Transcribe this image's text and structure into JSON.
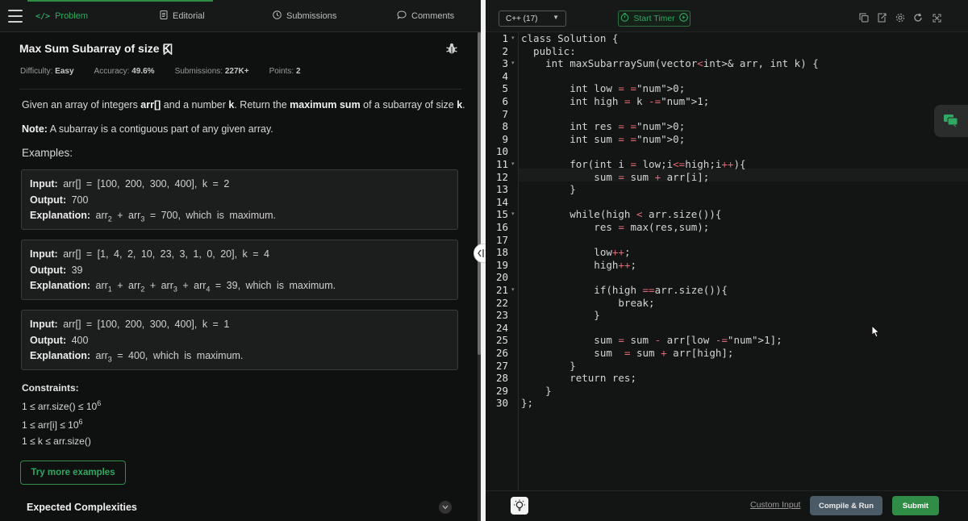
{
  "nav": {
    "tabs": [
      {
        "label": "Problem",
        "icon": "code-icon",
        "active": true
      },
      {
        "label": "Editorial",
        "icon": "document-icon"
      },
      {
        "label": "Submissions",
        "icon": "clock-icon"
      },
      {
        "label": "Comments",
        "icon": "chat-bubble-icon"
      }
    ]
  },
  "problem": {
    "title": "Max Sum Subarray of size K",
    "meta": {
      "difficulty_label": "Difficulty:",
      "difficulty": "Easy",
      "accuracy_label": "Accuracy:",
      "accuracy": "49.6%",
      "submissions_label": "Submissions:",
      "submissions": "227K+",
      "points_label": "Points:",
      "points": "2"
    },
    "description": {
      "p1": "Given an array of integers ",
      "arr": "arr[]",
      "p2": "  and a number ",
      "k": "k",
      "p3": ". Return the ",
      "maxsum": "maximum sum",
      "p4": " of a subarray of size ",
      "k2": "k",
      "p5": "."
    },
    "note_label": "Note:",
    "note_text": " A subarray is a contiguous part of any given array.",
    "examples_heading": "Examples:",
    "examples": [
      {
        "input_label": "Input:",
        "input": "arr[] = [100, 200, 300, 400], k = 2",
        "output_label": "Output:",
        "output": "700",
        "explanation_label": "Explanation:",
        "explanation": [
          {
            "t": "arr"
          },
          {
            "sub": "2"
          },
          {
            "t": " + arr"
          },
          {
            "sub": "3"
          },
          {
            "t": " = 700, which is maximum."
          }
        ]
      },
      {
        "input_label": "Input:",
        "input": "arr[] = [1, 4, 2, 10, 23, 3, 1, 0, 20], k = 4",
        "output_label": "Output:",
        "output": "39",
        "explanation_label": "Explanation:",
        "explanation": [
          {
            "t": "arr"
          },
          {
            "sub": "1"
          },
          {
            "t": " + arr"
          },
          {
            "sub": "2"
          },
          {
            "t": " + arr"
          },
          {
            "sub": "3"
          },
          {
            "t": " + arr"
          },
          {
            "sub": "4"
          },
          {
            "t": " = 39, which is maximum."
          }
        ]
      },
      {
        "input_label": "Input:",
        "input": "arr[] = [100, 200, 300, 400], k = 1",
        "output_label": "Output:",
        "output": "400",
        "explanation_label": "Explanation:",
        "explanation": [
          {
            "t": "arr"
          },
          {
            "sub": "3"
          },
          {
            "t": " = 400, which is maximum."
          }
        ]
      }
    ],
    "constraints_title": "Constraints:",
    "constraints": [
      {
        "base": "1 ≤ arr.size() ≤ 10",
        "sup": "6"
      },
      {
        "base": "1 ≤ arr[i] ≤ 10",
        "sup": "6"
      },
      {
        "base": "1 ≤ k ≤ arr.size()",
        "sup": ""
      }
    ],
    "try_more_label": "Try more examples",
    "expected_complexities": "Expected Complexities"
  },
  "editor": {
    "language": "C++ (17)",
    "timer_label": "Start Timer",
    "toolbar_icons": [
      "copy-icon",
      "export-icon",
      "settings-icon",
      "reset-icon",
      "fullscreen-icon"
    ],
    "code": [
      {
        "n": "1",
        "fold": true,
        "text": "class Solution {"
      },
      {
        "n": "2",
        "fold": false,
        "text": "  public:"
      },
      {
        "n": "3",
        "fold": true,
        "text": "    int maxSubarraySum(vector<int>& arr, int k) {"
      },
      {
        "n": "4",
        "fold": false,
        "text": ""
      },
      {
        "n": "5",
        "fold": false,
        "text": "        int low = 0;"
      },
      {
        "n": "6",
        "fold": false,
        "text": "        int high = k -1;"
      },
      {
        "n": "7",
        "fold": false,
        "text": ""
      },
      {
        "n": "8",
        "fold": false,
        "text": "        int res = 0;"
      },
      {
        "n": "9",
        "fold": false,
        "text": "        int sum = 0;"
      },
      {
        "n": "10",
        "fold": false,
        "text": ""
      },
      {
        "n": "11",
        "fold": true,
        "text": "        for(int i = low;i<=high;i++){"
      },
      {
        "n": "12",
        "fold": false,
        "text": "            sum = sum + arr[i];"
      },
      {
        "n": "13",
        "fold": false,
        "text": "        }"
      },
      {
        "n": "14",
        "fold": false,
        "text": ""
      },
      {
        "n": "15",
        "fold": true,
        "text": "        while(high < arr.size()){"
      },
      {
        "n": "16",
        "fold": false,
        "text": "            res = max(res,sum);"
      },
      {
        "n": "17",
        "fold": false,
        "text": ""
      },
      {
        "n": "18",
        "fold": false,
        "text": "            low++;"
      },
      {
        "n": "19",
        "fold": false,
        "text": "            high++;"
      },
      {
        "n": "20",
        "fold": false,
        "text": ""
      },
      {
        "n": "21",
        "fold": true,
        "text": "            if(high ==arr.size()){"
      },
      {
        "n": "22",
        "fold": false,
        "text": "                break;"
      },
      {
        "n": "23",
        "fold": false,
        "text": "            }"
      },
      {
        "n": "24",
        "fold": false,
        "text": ""
      },
      {
        "n": "25",
        "fold": false,
        "text": "            sum = sum - arr[low -1];"
      },
      {
        "n": "26",
        "fold": false,
        "text": "            sum  = sum + arr[high];"
      },
      {
        "n": "27",
        "fold": false,
        "text": "        }"
      },
      {
        "n": "28",
        "fold": false,
        "text": "        return res;"
      },
      {
        "n": "29",
        "fold": false,
        "text": "    }"
      },
      {
        "n": "30",
        "fold": false,
        "text": "};"
      }
    ],
    "custom_input_label": "Custom Input",
    "compile_run_label": "Compile & Run",
    "submit_label": "Submit"
  },
  "colors": {
    "accent_green": "#2f8d46",
    "panel_bg": "#0f1110",
    "editor_bg": "#131414"
  }
}
